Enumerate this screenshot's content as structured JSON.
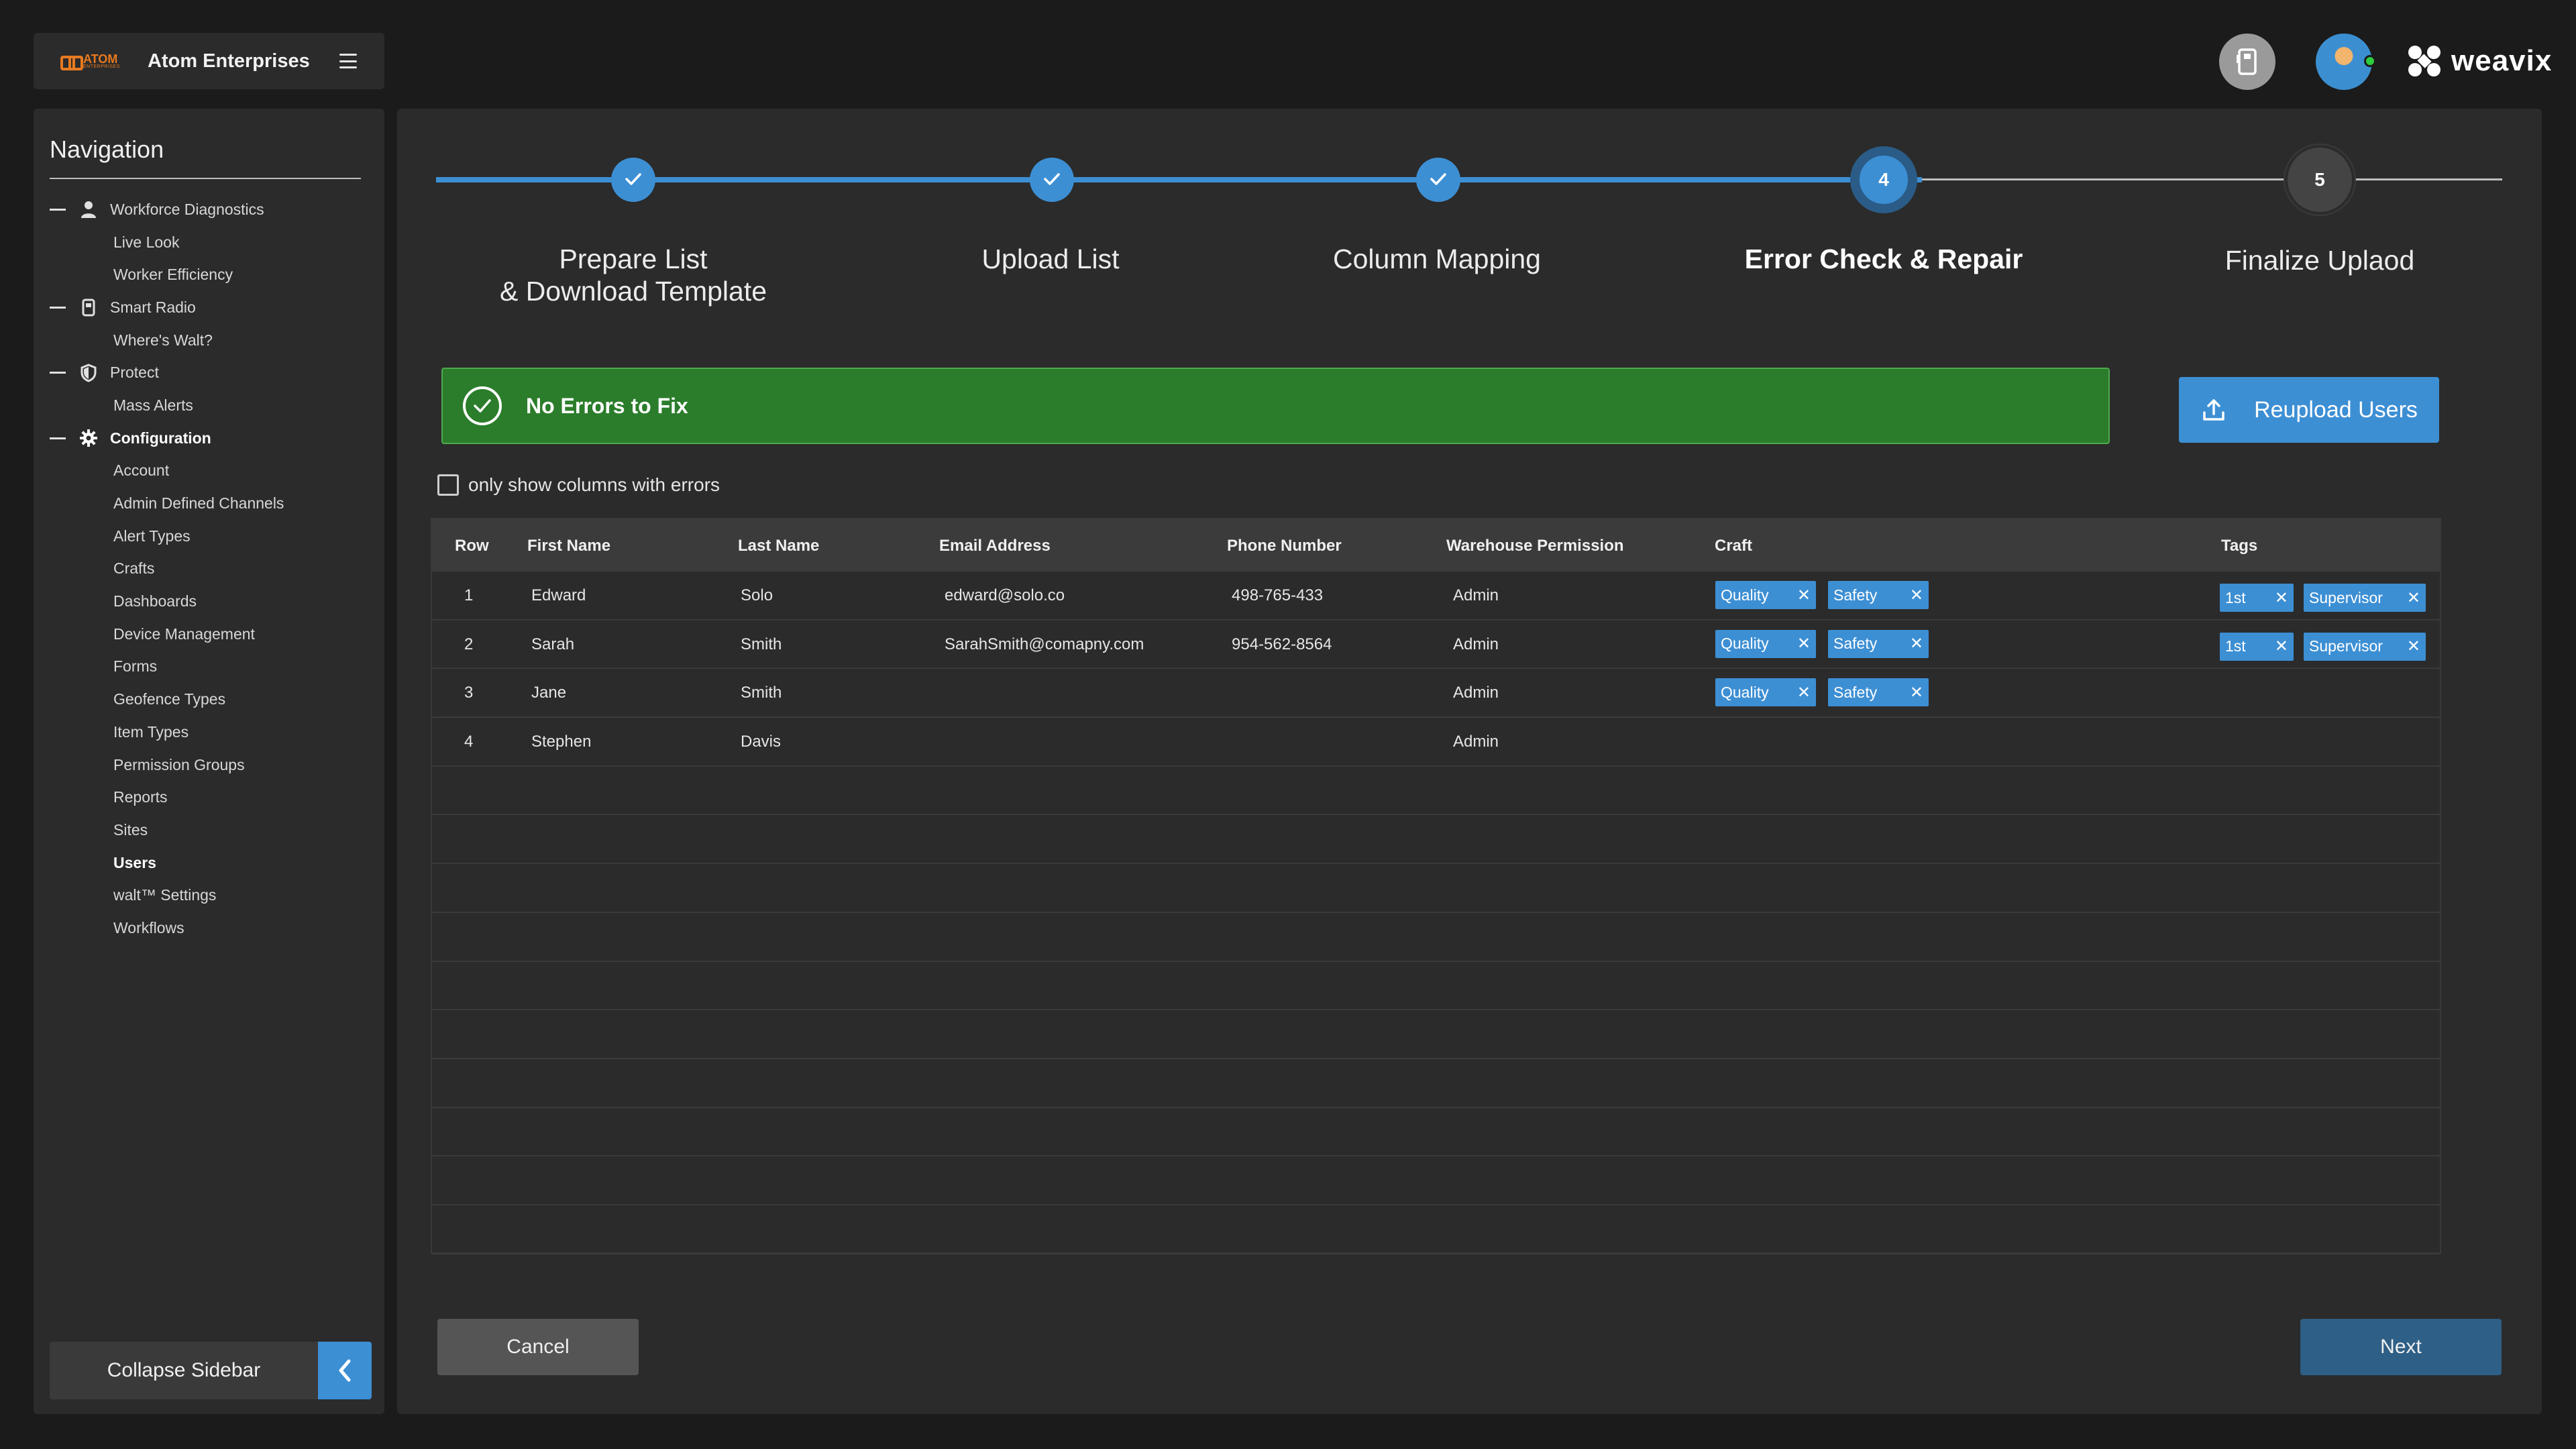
{
  "header": {
    "logo_text": "ATOM",
    "logo_subtext": "ENTERPRISES",
    "company_name": "Atom Enterprises",
    "brand_text": "weavix"
  },
  "sidebar": {
    "title": "Navigation",
    "items": [
      {
        "label": "Workforce Diagnostics",
        "type": "section",
        "icon": "person-icon"
      },
      {
        "label": "Live Look",
        "type": "child"
      },
      {
        "label": "Worker Efficiency",
        "type": "child"
      },
      {
        "label": "Smart Radio",
        "type": "section",
        "icon": "radio-icon"
      },
      {
        "label": "Where's Walt?",
        "type": "child"
      },
      {
        "label": "Protect",
        "type": "section",
        "icon": "shield-icon"
      },
      {
        "label": "Mass Alerts",
        "type": "child"
      },
      {
        "label": "Configuration",
        "type": "section",
        "icon": "gear-icon",
        "bold": true
      },
      {
        "label": "Account",
        "type": "child"
      },
      {
        "label": "Admin Defined Channels",
        "type": "child"
      },
      {
        "label": "Alert Types",
        "type": "child"
      },
      {
        "label": "Crafts",
        "type": "child"
      },
      {
        "label": "Dashboards",
        "type": "child"
      },
      {
        "label": "Device Management",
        "type": "child"
      },
      {
        "label": "Forms",
        "type": "child"
      },
      {
        "label": "Geofence Types",
        "type": "child"
      },
      {
        "label": "Item Types",
        "type": "child"
      },
      {
        "label": "Permission Groups",
        "type": "child"
      },
      {
        "label": "Reports",
        "type": "child"
      },
      {
        "label": "Sites",
        "type": "child"
      },
      {
        "label": "Users",
        "type": "child",
        "bold": true
      },
      {
        "label": "walt™ Settings",
        "type": "child"
      },
      {
        "label": "Workflows",
        "type": "child"
      }
    ],
    "collapse_label": "Collapse Sidebar"
  },
  "stepper": {
    "steps": [
      {
        "number": "1",
        "label": "Prepare List\n& Download Template",
        "status": "done"
      },
      {
        "number": "2",
        "label": "Upload List",
        "status": "done"
      },
      {
        "number": "3",
        "label": "Column Mapping",
        "status": "done"
      },
      {
        "number": "4",
        "label": "Error Check & Repair",
        "status": "active"
      },
      {
        "number": "5",
        "label": "Finalize Uplaod",
        "status": "todo"
      }
    ]
  },
  "alert": {
    "text": "No Errors to Fix",
    "color": "#2b7d2b"
  },
  "reupload_label": "Reupload Users",
  "filter_label": "only show columns with errors",
  "table": {
    "columns": [
      "Row",
      "First Name",
      "Last Name",
      "Email Address",
      "Phone Number",
      "Warehouse Permission",
      "Craft",
      "Tags"
    ],
    "rows": [
      {
        "row": "1",
        "first": "Edward",
        "last": "Solo",
        "email": "edward@solo.co",
        "phone": "498-765-433",
        "permission": "Admin",
        "crafts": [
          "Quality",
          "Safety"
        ],
        "tags": [
          "1st",
          "Supervisor"
        ]
      },
      {
        "row": "2",
        "first": "Sarah",
        "last": "Smith",
        "email": "SarahSmith@comapny.com",
        "phone": "954-562-8564",
        "permission": "Admin",
        "crafts": [
          "Quality",
          "Safety"
        ],
        "tags": [
          "1st",
          "Supervisor"
        ]
      },
      {
        "row": "3",
        "first": "Jane",
        "last": "Smith",
        "email": "",
        "phone": "",
        "permission": "Admin",
        "crafts": [
          "Quality",
          "Safety"
        ],
        "tags": []
      },
      {
        "row": "4",
        "first": "Stephen",
        "last": "Davis",
        "email": "",
        "phone": "",
        "permission": "Admin",
        "crafts": [],
        "tags": []
      }
    ],
    "empty_rows": 10
  },
  "footer": {
    "cancel_label": "Cancel",
    "next_label": "Next"
  },
  "colors": {
    "accent": "#3d8fd4",
    "success": "#2b7d2b",
    "background": "#1b1b1b",
    "panel": "#2b2b2b"
  }
}
